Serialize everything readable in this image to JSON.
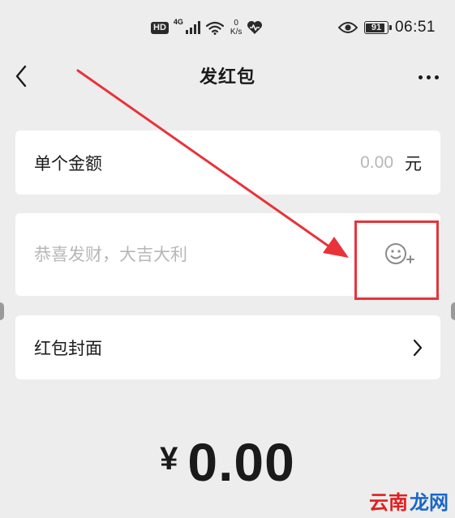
{
  "status_bar": {
    "hd_badge": "HD",
    "network": "4G",
    "speed_value": "0",
    "speed_unit": "K/s",
    "battery_level": "91",
    "battery_fraction": 0.91,
    "time": "06:51",
    "icons": [
      "signal-icon",
      "wifi-icon",
      "heart-icon",
      "eye-icon",
      "battery-icon"
    ]
  },
  "nav": {
    "title": "发红包",
    "back_icon": "chevron-left-icon",
    "more_icon": "more-icon"
  },
  "amount_row": {
    "label": "单个金额",
    "placeholder": "0.00",
    "unit": "元"
  },
  "greeting_row": {
    "placeholder": "恭喜发财，大吉大利",
    "value": "",
    "emoji_icon": "emoji-add-icon"
  },
  "cover_row": {
    "label": "红包封面",
    "chevron_icon": "chevron-right-icon"
  },
  "total": {
    "currency": "¥",
    "value": "0.00"
  },
  "watermark": {
    "part1": "云南",
    "part2": "龙网"
  },
  "colors": {
    "background": "#ededed",
    "card": "#ffffff",
    "text": "#1a1a1a",
    "placeholder": "#b7b7b7",
    "annotation_red": "#e8333a",
    "watermark_red": "#e02020",
    "watermark_blue": "#1a66c8"
  }
}
